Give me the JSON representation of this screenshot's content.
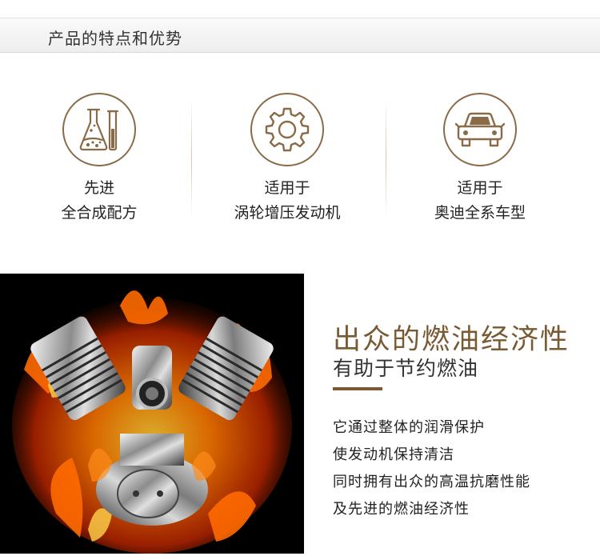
{
  "header": {
    "title": "产品的特点和优势"
  },
  "features": [
    {
      "icon": "flask-icon",
      "line1": "先进",
      "line2": "全合成配方"
    },
    {
      "icon": "gear-icon",
      "line1": "适用于",
      "line2": "涡轮增压发动机"
    },
    {
      "icon": "car-icon",
      "line1": "适用于",
      "line2": "奥迪全系车型"
    }
  ],
  "benefit": {
    "title": "出众的燃油经济性",
    "subtitle": "有助于节约燃油",
    "lines": [
      "它通过整体的润滑保护",
      "使发动机保持清洁",
      "同时拥有出众的高温抗磨性能",
      "及先进的燃油经济性"
    ]
  },
  "colors": {
    "accent": "#7a5a33",
    "icon_stroke": "#8a6b47",
    "header_bg": "#f0f0f0"
  }
}
